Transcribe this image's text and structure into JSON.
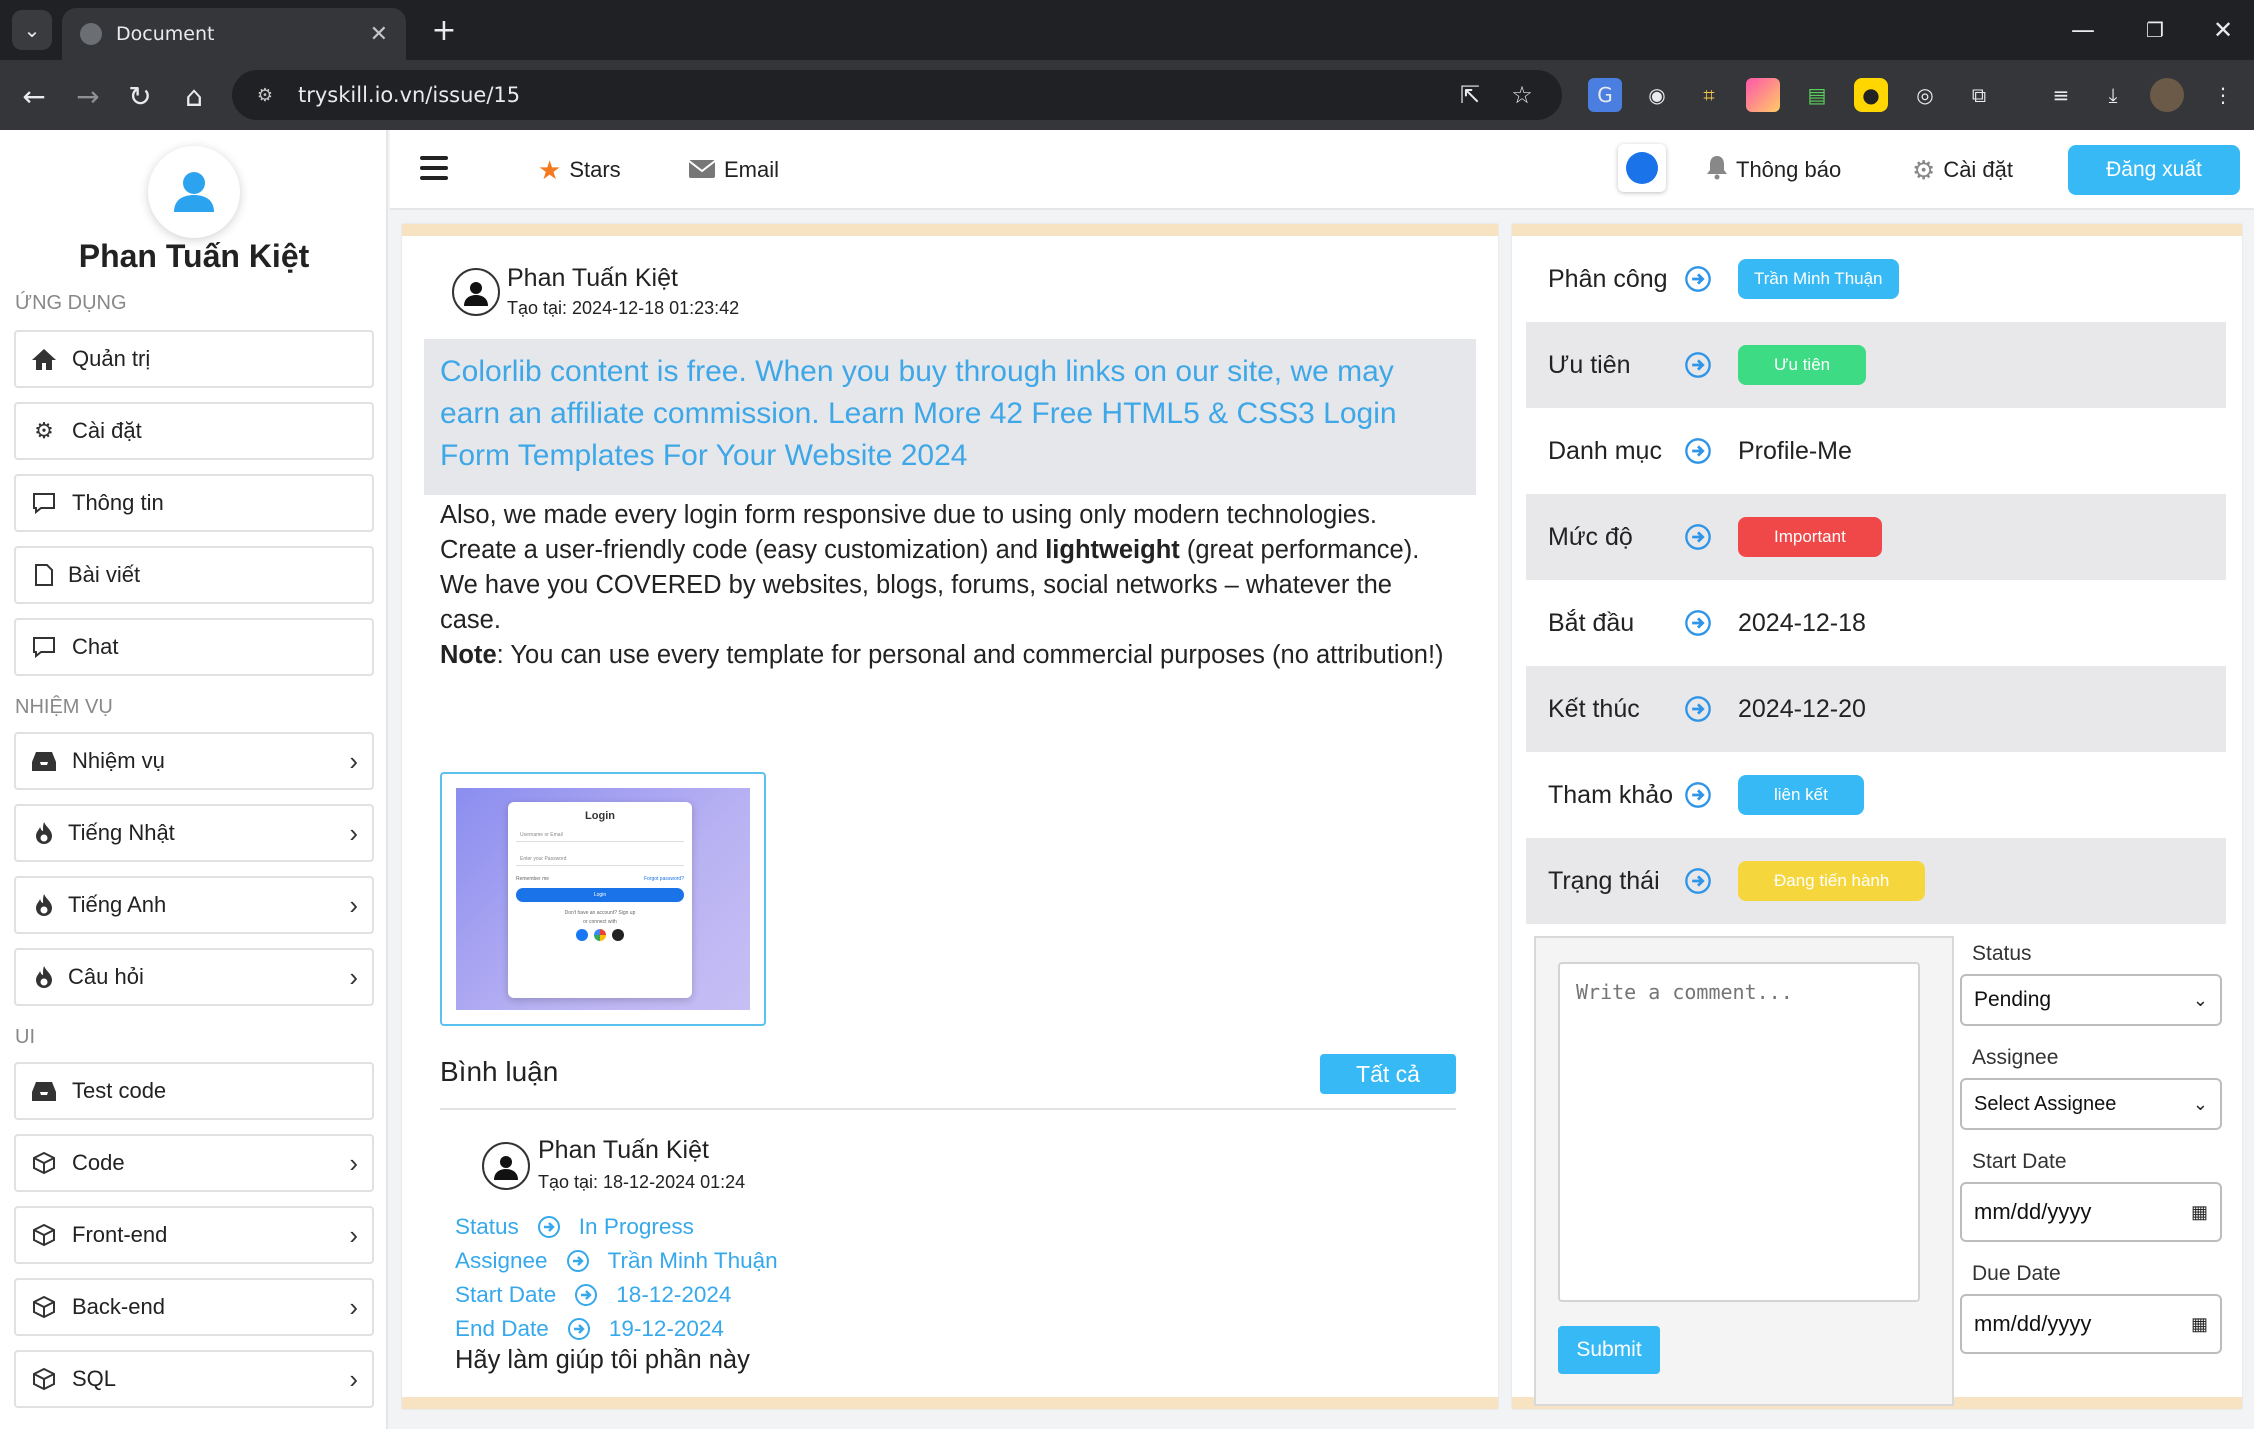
{
  "browser": {
    "tab_title": "Document",
    "url": "tryskill.io.vn/issue/15"
  },
  "sidebar": {
    "profile_name": "Phan Tuấn Kiệt",
    "sections": {
      "apps": "ỨNG DỤNG",
      "tasks": "NHIỆM VỤ",
      "ui": "UI"
    },
    "items": [
      {
        "label": "Quản trị",
        "icon": "home-icon"
      },
      {
        "label": "Cài đặt",
        "icon": "gear-icon"
      },
      {
        "label": "Thông tin",
        "icon": "message-icon"
      },
      {
        "label": "Bài viết",
        "icon": "document-icon"
      },
      {
        "label": "Chat",
        "icon": "message-icon"
      },
      {
        "label": "Nhiệm vụ",
        "icon": "inbox-icon"
      },
      {
        "label": "Tiếng Nhật",
        "icon": "fire-icon"
      },
      {
        "label": "Tiếng Anh",
        "icon": "fire-icon"
      },
      {
        "label": "Câu hỏi",
        "icon": "fire-icon"
      },
      {
        "label": "Test code",
        "icon": "inbox-icon"
      },
      {
        "label": "Code",
        "icon": "cube-icon"
      },
      {
        "label": "Front-end",
        "icon": "cube-icon"
      },
      {
        "label": "Back-end",
        "icon": "cube-icon"
      },
      {
        "label": "SQL",
        "icon": "cube-icon"
      }
    ]
  },
  "header": {
    "stars": "Stars",
    "email": "Email",
    "notifications": "Thông báo",
    "settings": "Cài đặt",
    "logout": "Đăng xuất"
  },
  "post": {
    "author": "Phan Tuấn Kiệt",
    "created": "Tạo tại: 2024-12-18 01:23:42",
    "banner": "Colorlib content is free. When you buy through links on our site, we may earn an affiliate commission. Learn More 42 Free HTML5 & CSS3 Login Form Templates For Your Website 2024",
    "body_line1": "Also, we made every login form responsive due to using only modern technologies.",
    "body_line2a": "Create a user-friendly code (easy customization) and ",
    "body_line2b": "lightweight",
    "body_line2c": " (great performance).",
    "body_line3": "We have you COVERED by websites, blogs, forums, social networks – whatever the case.",
    "body_note_label": "Note",
    "body_note": ": You can use every template for personal and commercial purposes (no attribution!)",
    "thumbnail": {
      "title": "Login",
      "username_placeholder": "Username or Email",
      "password_placeholder": "Enter your Password",
      "remember": "Remember me",
      "forgot": "Forgot password?",
      "button": "Login",
      "no_account": "Don't have an account? Sign up",
      "connect": "or connect with"
    }
  },
  "comments": {
    "heading": "Bình luận",
    "all_button": "Tất cả",
    "items": [
      {
        "author": "Phan Tuấn Kiệt",
        "created": "Tạo tại: 18-12-2024 01:24",
        "status_label": "Status",
        "status_value": "In Progress",
        "assignee_label": "Assignee",
        "assignee_value": "Trần Minh Thuận",
        "start_label": "Start Date",
        "start_value": "18-12-2024",
        "end_label": "End Date",
        "end_value": "19-12-2024",
        "text": "Hãy làm giúp tôi phần này"
      }
    ]
  },
  "details": {
    "rows": [
      {
        "key": "Phân công",
        "value": "Trần Minh Thuận",
        "type": "badge",
        "color": "#36b9f5"
      },
      {
        "key": "Ưu tiên",
        "value": "Ưu tiên",
        "type": "badge",
        "color": "#3ddc84"
      },
      {
        "key": "Danh mục",
        "value": "Profile-Me",
        "type": "text"
      },
      {
        "key": "Mức độ",
        "value": "Important",
        "type": "badge",
        "color": "#f04848"
      },
      {
        "key": "Bắt đầu",
        "value": "2024-12-18",
        "type": "text"
      },
      {
        "key": "Kết thúc",
        "value": "2024-12-20",
        "type": "text"
      },
      {
        "key": "Tham khảo",
        "value": "liên kết",
        "type": "badge",
        "color": "#36b9f5"
      },
      {
        "key": "Trạng thái",
        "value": "Đang tiến hành",
        "type": "badge",
        "color": "#f5d63d"
      }
    ]
  },
  "comment_form": {
    "placeholder": "Write a comment...",
    "submit": "Submit",
    "status_label": "Status",
    "status_value": "Pending",
    "assignee_label": "Assignee",
    "assignee_value": "Select Assignee",
    "start_label": "Start Date",
    "start_value": "mm/dd/yyyy",
    "due_label": "Due Date",
    "due_value": "mm/dd/yyyy"
  },
  "colors": {
    "accent": "#36b9f5",
    "panel_border": "#f7e3c2",
    "link_text": "#36a8ec"
  }
}
